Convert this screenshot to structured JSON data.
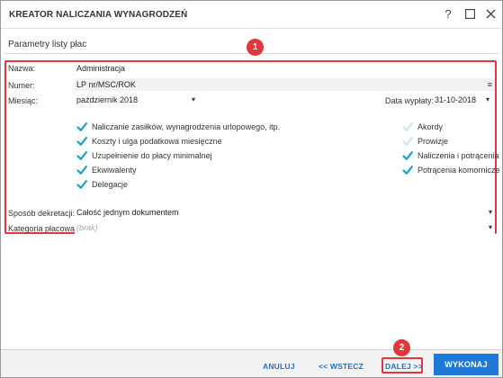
{
  "window": {
    "title": "KREATOR NALICZANIA WYNAGRODZEŃ",
    "help_glyph": "?",
    "maximize_glyph": "☐",
    "close_glyph": "✕"
  },
  "section": {
    "title": "Parametry listy płac"
  },
  "badges": {
    "panel": "1",
    "next": "2"
  },
  "form": {
    "nazwa": {
      "label": "Nazwa:",
      "value": "Administracja"
    },
    "numer": {
      "label": "Numer:",
      "value": "LP nr/MSC/ROK"
    },
    "miesiac": {
      "label": "Miesiąc:",
      "value": "październik 2018"
    },
    "data_wyplaty": {
      "label": "Data wypłaty:",
      "value": "31-10-2018"
    },
    "sposob_dekretacji": {
      "label": "Sposób dekretacji:",
      "value": "Całość jednym dokumentem"
    },
    "kategoria_placowa": {
      "label": "Kategoria płacowa:",
      "placeholder": "(brak)"
    }
  },
  "checkboxes_left": [
    {
      "label": "Naliczanie zasiłków, wynagrodzenia urlopowego, itp.",
      "checked": true
    },
    {
      "label": "Koszty i ulga podatkowa miesięczne",
      "checked": true
    },
    {
      "label": "Uzupełnienie do płacy minimalnej",
      "checked": true
    },
    {
      "label": "Ekwiwalenty",
      "checked": true
    },
    {
      "label": "Delegacje",
      "checked": true
    }
  ],
  "checkboxes_right": [
    {
      "label": "Akordy",
      "checked": false
    },
    {
      "label": "Prowizje",
      "checked": false
    },
    {
      "label": "Naliczenia i potrącenia",
      "checked": true
    },
    {
      "label": "Potrącenia komornicze",
      "checked": true
    }
  ],
  "footer": {
    "cancel": "ANULUJ",
    "back": "<< WSTECZ",
    "next": "DALEJ >>",
    "execute": "WYKONAJ"
  },
  "colors": {
    "accent": "#1e78d6",
    "highlight": "#e0383e",
    "check_on": "#1aa3c9",
    "check_off": "#cfe4ef"
  }
}
